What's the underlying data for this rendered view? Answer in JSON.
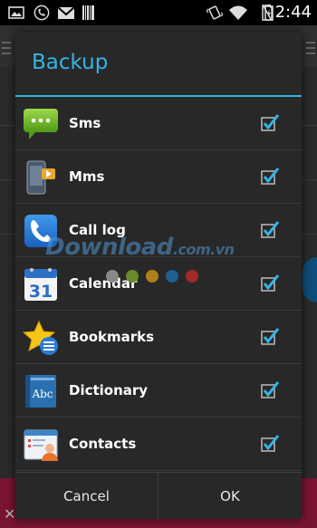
{
  "status_bar": {
    "time": "2:44",
    "icons": [
      "image-icon",
      "phone-icon",
      "gmail-icon",
      "barcode-icon",
      "vibrate-icon",
      "wifi-icon",
      "no-sim-icon",
      "battery-icon"
    ]
  },
  "dialog": {
    "title": "Backup",
    "accent_color": "#33b5e5",
    "items": [
      {
        "label": "Sms",
        "icon": "sms-icon",
        "checked": true
      },
      {
        "label": "Mms",
        "icon": "mms-icon",
        "checked": true
      },
      {
        "label": "Call log",
        "icon": "call-log-icon",
        "checked": true
      },
      {
        "label": "Calendar",
        "icon": "calendar-icon",
        "checked": true,
        "icon_text": "31"
      },
      {
        "label": "Bookmarks",
        "icon": "bookmarks-icon",
        "checked": true
      },
      {
        "label": "Dictionary",
        "icon": "dictionary-icon",
        "checked": true,
        "icon_text": "Abc"
      },
      {
        "label": "Contacts",
        "icon": "contacts-icon",
        "checked": true
      }
    ],
    "buttons": {
      "cancel": "Cancel",
      "ok": "OK"
    }
  },
  "watermark": {
    "text": "Download",
    "suffix": ".com.vn",
    "dot_colors": [
      "#888888",
      "#6a8a2a",
      "#b07f1e",
      "#1f5f8f",
      "#a02a2a"
    ]
  }
}
